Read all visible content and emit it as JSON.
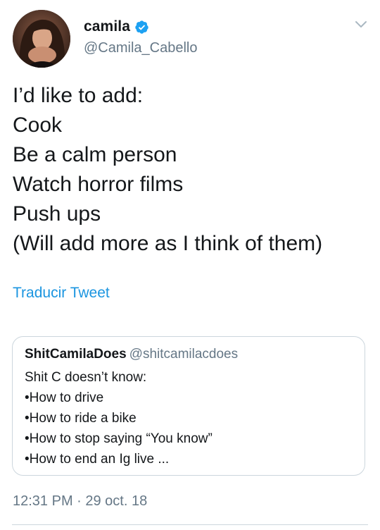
{
  "author": {
    "display_name": "camila",
    "handle": "@Camila_Cabello",
    "verified": true,
    "verified_color": "#1da1f2"
  },
  "tweet": {
    "lines": [
      "I’d like to add:",
      "Cook",
      "Be a calm person",
      "Watch horror films",
      "Push ups",
      "(Will add more as I think of them)"
    ],
    "translate_label": "Traducir Tweet",
    "timestamp": "12:31 PM · 29 oct. 18"
  },
  "quoted_tweet": {
    "display_name": "ShitCamilaDoes",
    "handle": "@shitcamilacdoes",
    "lines": [
      "Shit C doesn’t know:",
      "•How to drive",
      "•How to ride a bike",
      "•How to stop saying “You know”",
      "•How to end an Ig live ..."
    ]
  },
  "icons": {
    "menu": "chevron-down-icon",
    "verified": "verified-badge-icon"
  },
  "colors": {
    "link": "#1b95e0",
    "secondary_text": "#657786",
    "border": "#ccd6dd"
  }
}
